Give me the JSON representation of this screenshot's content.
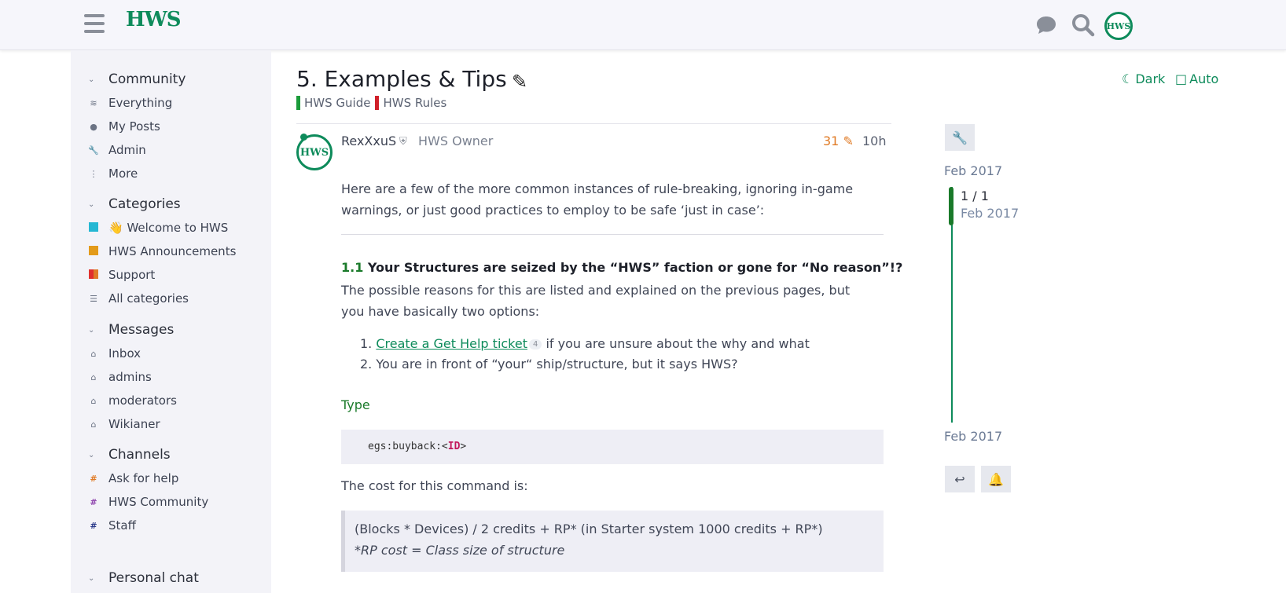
{
  "header": {
    "logo_text": "HWS",
    "avatar_text": "HWS",
    "icons": [
      "hamburger-icon",
      "chat-icon",
      "search-icon"
    ]
  },
  "sidebar": {
    "community": {
      "title": "Community",
      "items": [
        {
          "label": "Everything",
          "icon": "layers-icon"
        },
        {
          "label": "My Posts",
          "icon": "user-icon"
        },
        {
          "label": "Admin",
          "icon": "wrench-icon"
        },
        {
          "label": "More",
          "icon": "more-icon"
        }
      ]
    },
    "categories": {
      "title": "Categories",
      "items": [
        {
          "label": "👋 Welcome to HWS",
          "color": "#25b7d3"
        },
        {
          "label": "HWS Announcements",
          "color": "#e39b1a"
        },
        {
          "label": "Support",
          "color": "#e0302d"
        },
        {
          "label": "All categories",
          "icon": "list-icon"
        }
      ]
    },
    "messages": {
      "title": "Messages",
      "items": [
        {
          "label": "Inbox"
        },
        {
          "label": "admins"
        },
        {
          "label": "moderators"
        },
        {
          "label": "Wikianer"
        }
      ]
    },
    "channels": {
      "title": "Channels",
      "items": [
        {
          "label": "Ask for help",
          "color": "#e07b26"
        },
        {
          "label": "HWS Community",
          "color": "#8e44ad"
        },
        {
          "label": "Staff",
          "color": "#2b3a8a"
        }
      ]
    },
    "personal_chat": {
      "title": "Personal chat"
    }
  },
  "topic": {
    "title": "5. Examples & Tips",
    "tags": [
      {
        "label": "HWS Guide",
        "color": "#1a9b3a"
      },
      {
        "label": "HWS Rules",
        "color": "#d0202a"
      }
    ],
    "theme_dark": "Dark",
    "theme_auto": "Auto"
  },
  "post": {
    "avatar_text": "HWS",
    "username": "RexXxuS",
    "user_title": "HWS Owner",
    "edits": "31",
    "age": "10h",
    "intro_line1": "Here are a few of the more common instances of rule-breaking, ignoring in-game",
    "intro_line2": "warnings, or just good practices to employ to be safe ‘just in case’:",
    "heading_num": "1.1",
    "heading_text": " Your Structures are seized by the “HWS” faction or gone for “No reason”!?",
    "para_line1": "The possible reasons for this are listed and explained on the previous pages, but",
    "para_line2": "you have basically two options:",
    "list_item1_link": "Create a Get Help ticket",
    "list_item1_badge": "4",
    "list_item1_rest": " if you are unsure about the why and what",
    "list_item2": "You are in front of “your“ ship/structure, but it says HWS?",
    "type_label": "Type",
    "code_prefix": "egs:buyback:<",
    "code_kw": "ID",
    "code_suffix": ">",
    "cost_text": "The cost for this command is:",
    "quote_line1": "(Blocks * Devices) / 2 credits + RP* (in Starter system 1000 credits + RP*)",
    "quote_line2": "*RP cost = Class size of structure"
  },
  "timeline": {
    "start_date": "Feb 2017",
    "position": "1 / 1",
    "position_date": "Feb 2017",
    "end_date": "Feb 2017"
  }
}
